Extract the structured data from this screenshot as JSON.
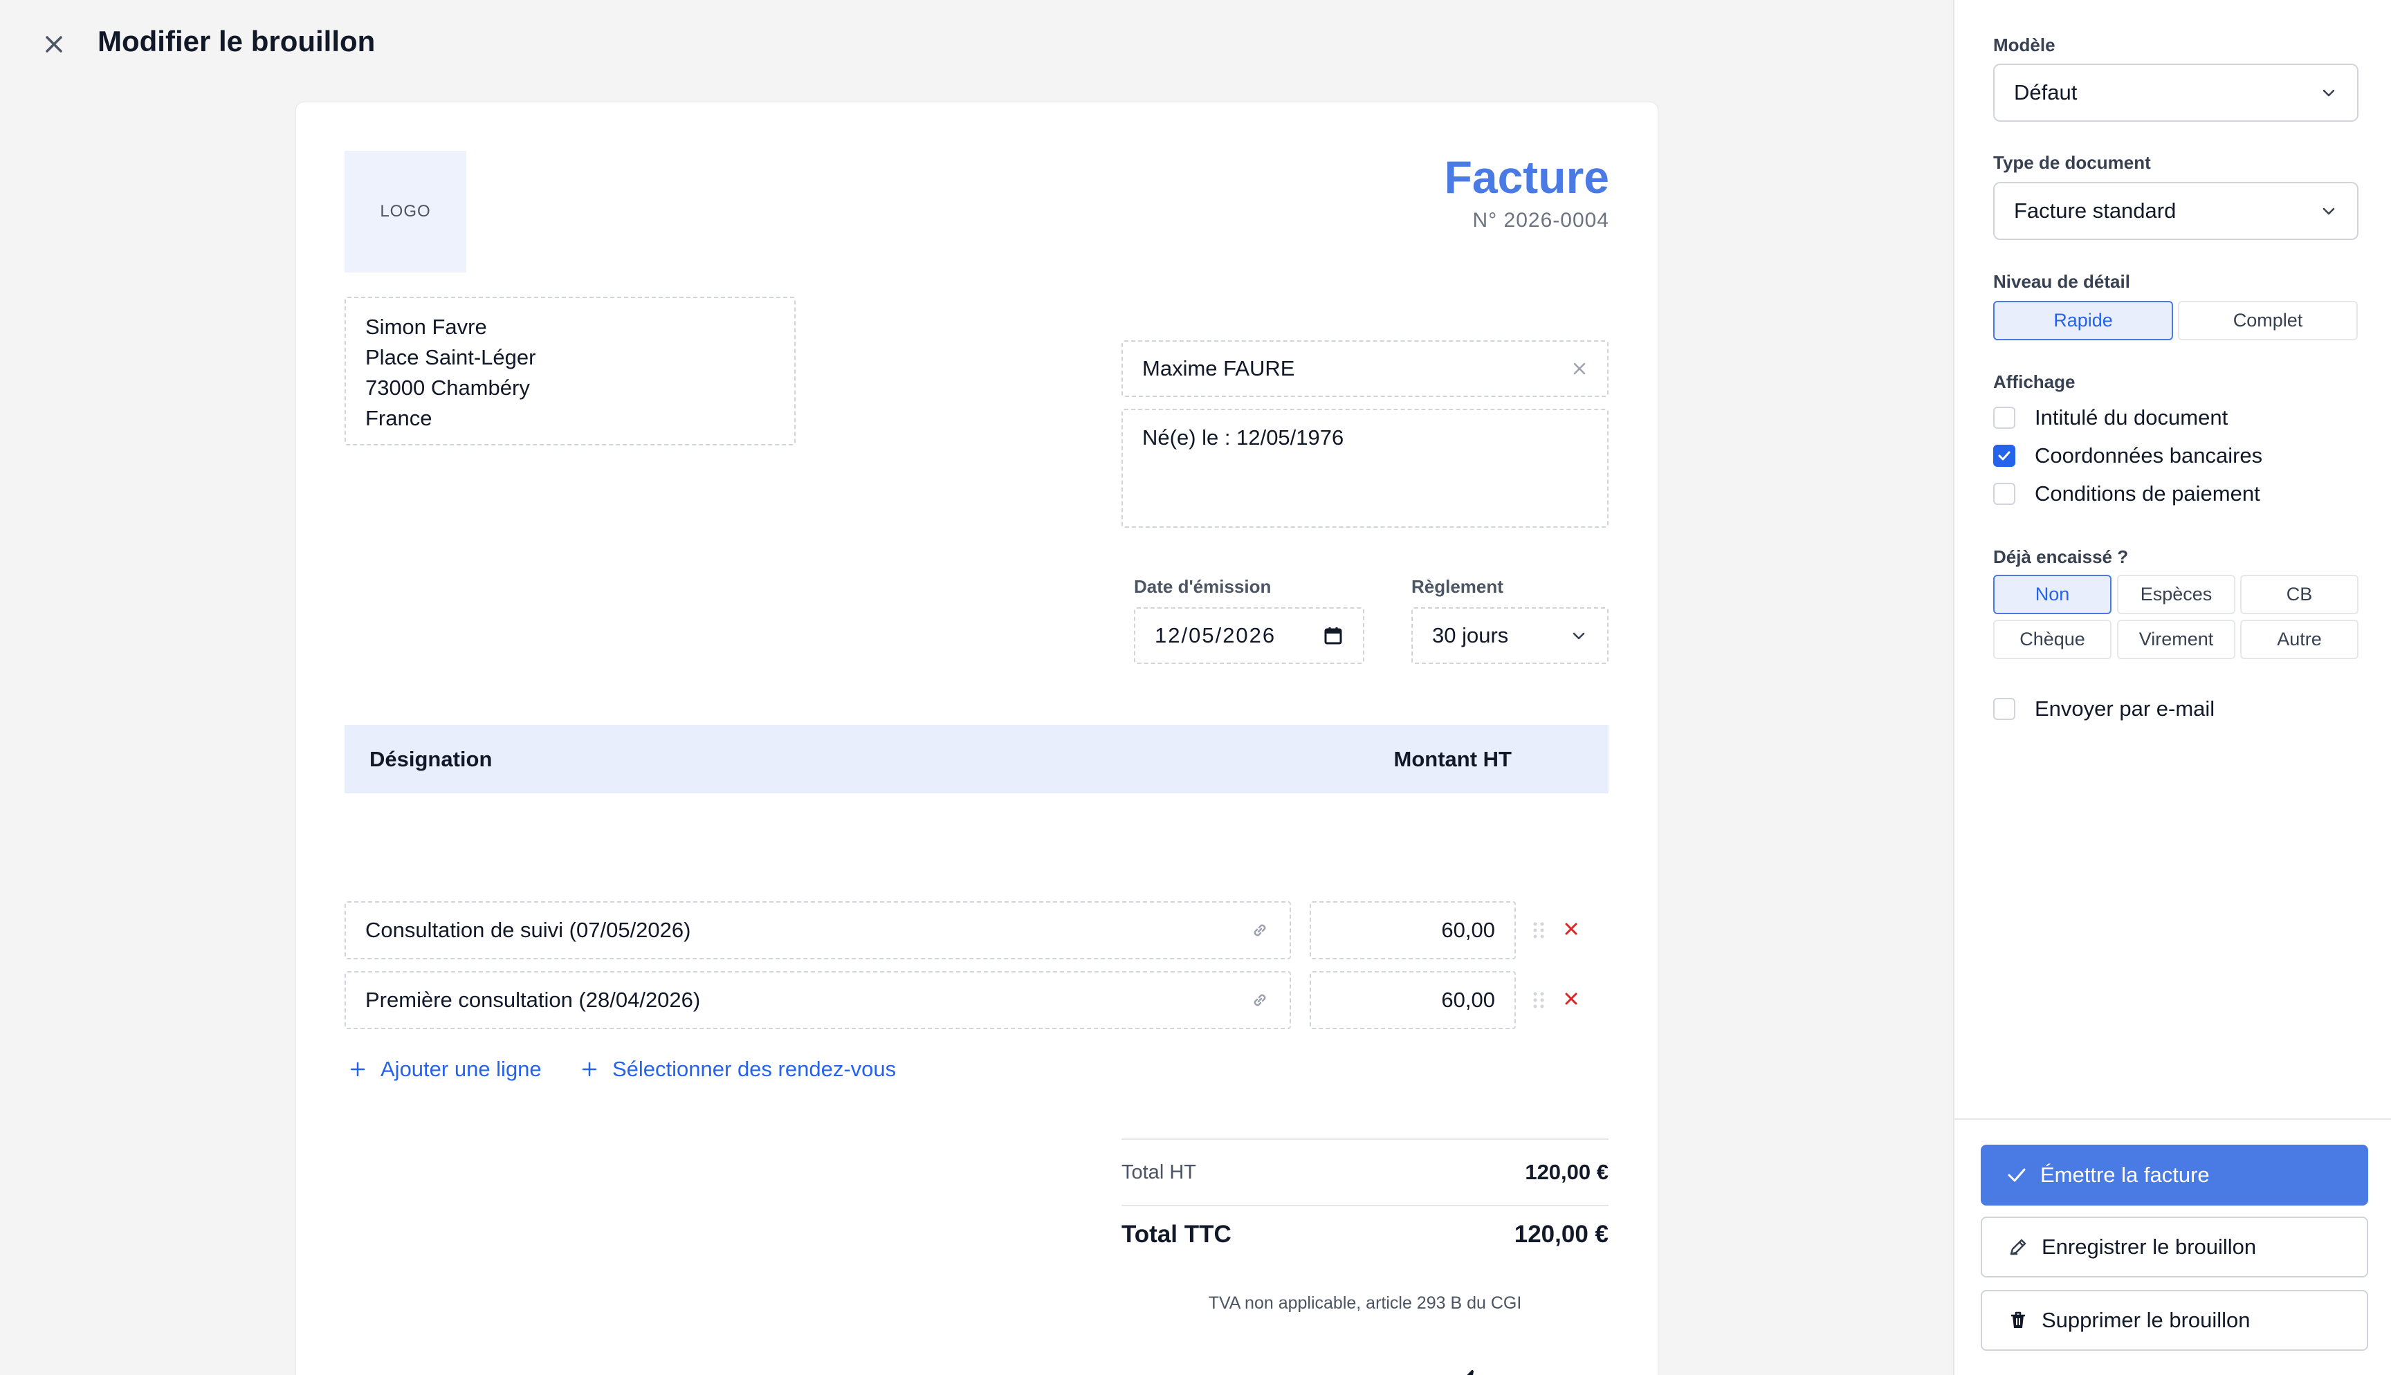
{
  "header": {
    "title": "Modifier le brouillon"
  },
  "invoice": {
    "logo_placeholder": "LOGO",
    "doc_title": "Facture",
    "doc_number": "N° 2026-0004",
    "sender": {
      "name": "Simon Favre",
      "street": "Place Saint-Léger",
      "city": "73000 Chambéry",
      "country": "France"
    },
    "client": {
      "name": "Maxime FAURE",
      "info": "Né(e) le : 12/05/1976"
    },
    "date_label": "Date d'émission",
    "date_value": "12/05/2026",
    "payment_label": "Règlement",
    "payment_value": "30 jours",
    "table": {
      "col_designation": "Désignation",
      "col_amount": "Montant HT",
      "rows": [
        {
          "designation": "Consultation de suivi (07/05/2026)",
          "amount": "60,00"
        },
        {
          "designation": "Première consultation (28/04/2026)",
          "amount": "60,00"
        }
      ]
    },
    "add_line": "Ajouter une ligne",
    "select_appointments": "Sélectionner des rendez-vous",
    "totals": {
      "ht_label": "Total HT",
      "ht_value": "120,00 €",
      "ttc_label": "Total TTC",
      "ttc_value": "120,00 €"
    },
    "vat_note": "TVA non applicable, article 293 B du CGI"
  },
  "sidebar": {
    "model_label": "Modèle",
    "model_value": "Défaut",
    "doc_type_label": "Type de document",
    "doc_type_value": "Facture standard",
    "detail_label": "Niveau de détail",
    "detail_options": [
      "Rapide",
      "Complet"
    ],
    "detail_selected": "Rapide",
    "display_label": "Affichage",
    "display_options": [
      {
        "label": "Intitulé du document",
        "checked": false
      },
      {
        "label": "Coordonnées bancaires",
        "checked": true
      },
      {
        "label": "Conditions de paiement",
        "checked": false
      }
    ],
    "paid_label": "Déjà encaissé ?",
    "paid_options": [
      "Non",
      "Espèces",
      "CB",
      "Chèque",
      "Virement",
      "Autre"
    ],
    "paid_selected": "Non",
    "email_label": "Envoyer par e-mail",
    "email_checked": false,
    "buttons": {
      "issue": "Émettre la facture",
      "save": "Enregistrer le brouillon",
      "delete": "Supprimer le brouillon"
    }
  },
  "colors": {
    "accent": "#4a7be5",
    "link": "#2563eb",
    "danger": "#dc2626",
    "table_header_bg": "#e8eefc"
  }
}
